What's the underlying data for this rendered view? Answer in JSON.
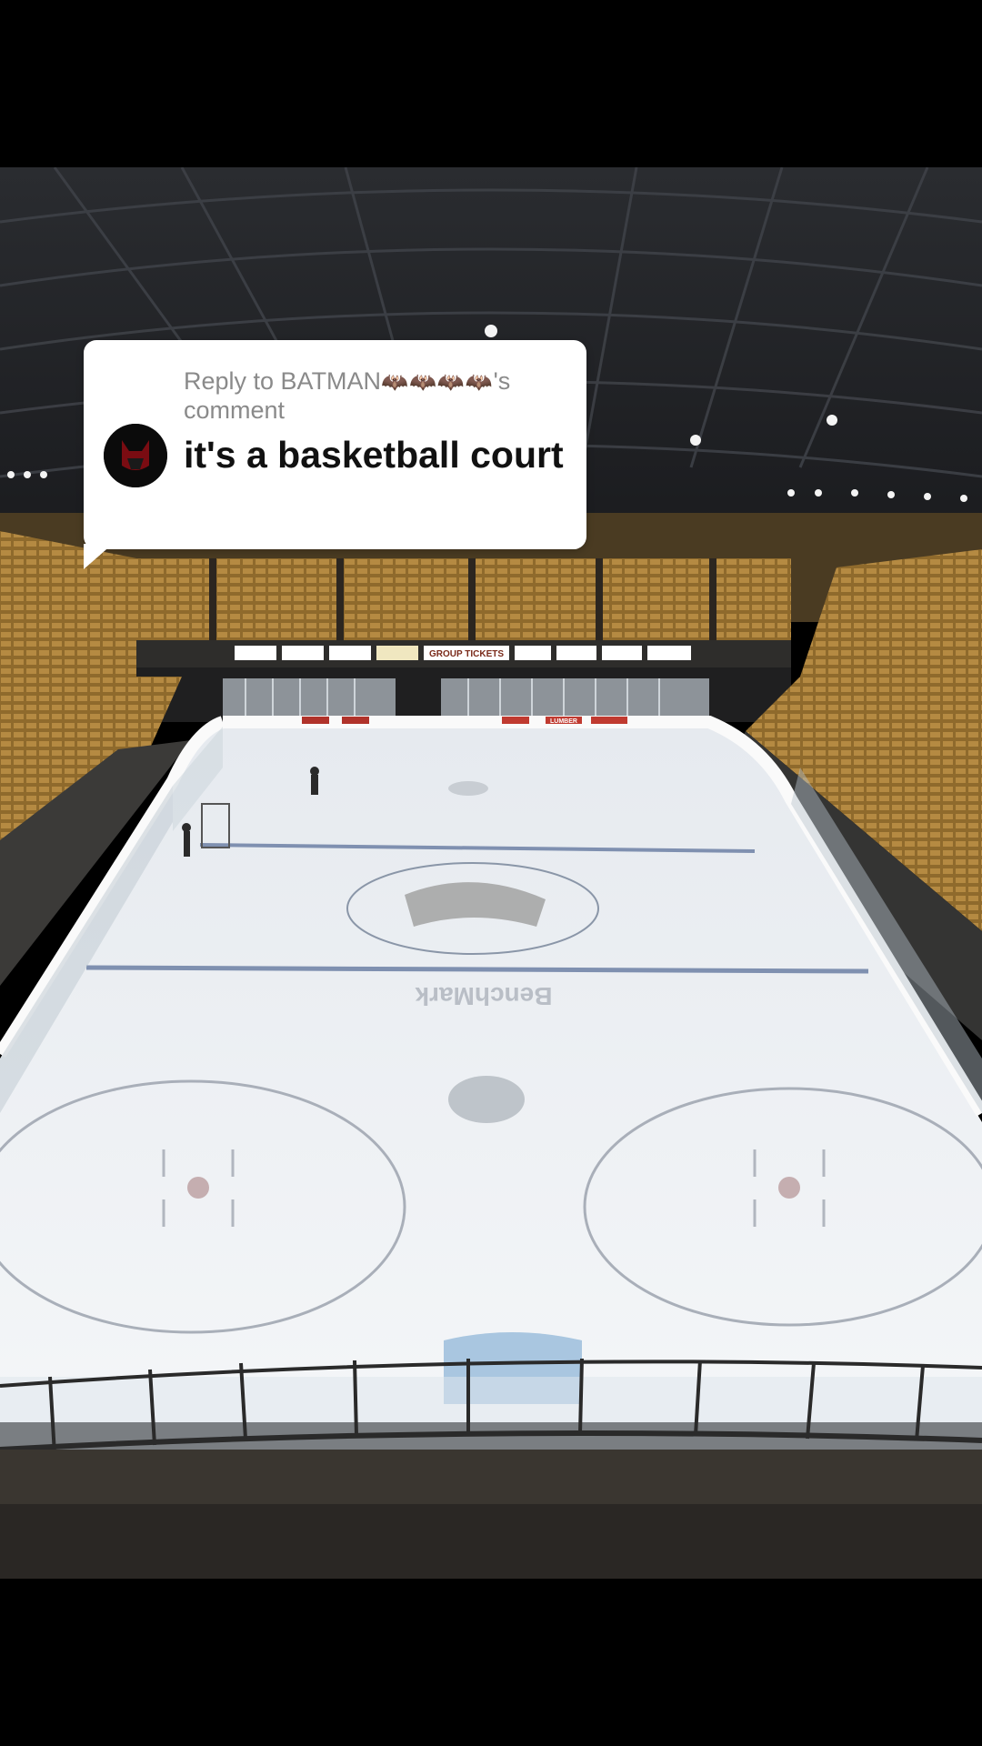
{
  "reply_bubble": {
    "reply_prefix": "Reply to BATMAN",
    "reply_emojis": "🦇🦇🦇🦇",
    "reply_suffix": "'s comment",
    "comment_text": "it's a basketball court"
  },
  "arena_signage": {
    "sign_group_tickets": "GROUP TICKETS",
    "sign_lumber": "LUMBER",
    "center_logo": "BenchMark"
  },
  "colors": {
    "page_background": "#000000",
    "bubble_background": "#ffffff",
    "comment_text": "#111111",
    "reply_text": "#8a8a8a",
    "ice": "#eef1f5",
    "seats": "#a07a35"
  }
}
